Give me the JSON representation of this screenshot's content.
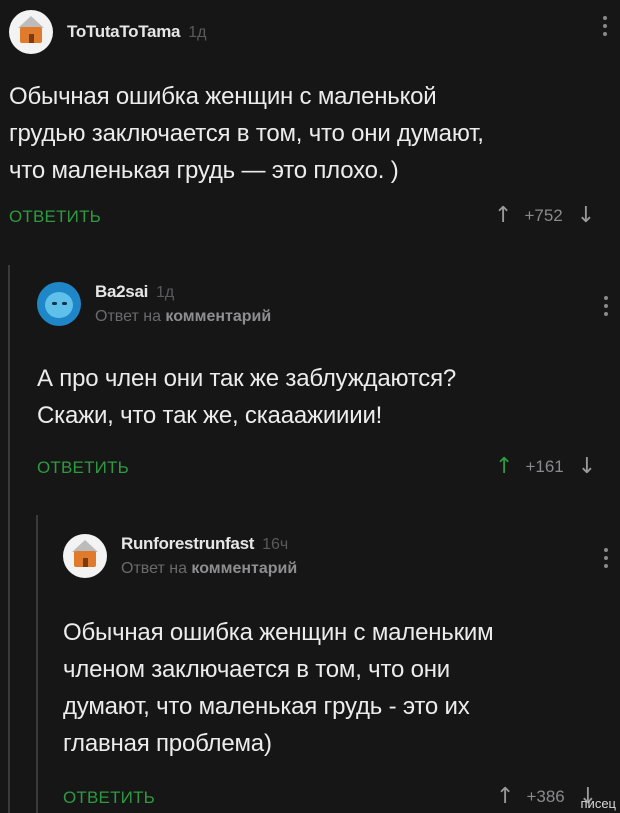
{
  "comments": [
    {
      "username": "ToTutaToTama",
      "time": "1д",
      "text": "Обычная ошибка женщин с маленькой\nгрудью заключается в том, что они думают,\nчто маленькая грудь — это плохо. )",
      "reply_label": "ОТВЕТИТЬ",
      "score": "+752",
      "avatar": "house-icon"
    },
    {
      "username": "Ba2sai",
      "time": "1д",
      "reply_to_prefix": "Ответ на",
      "reply_to_target": "комментарий",
      "text": "А про член они так же заблуждаются?\nСкажи,  что так же, скааажииии!",
      "reply_label": "ОТВЕТИТЬ",
      "score": "+161",
      "avatar": "blue-face-icon"
    },
    {
      "username": "Runforestrunfast",
      "time": "16ч",
      "reply_to_prefix": "Ответ на",
      "reply_to_target": "комментарий",
      "text": "Обычная ошибка женщин с маленьким\nчленом заключается в том, что они\nдумают, что маленькая грудь - это их\nглавная проблема)",
      "reply_label": "ОТВЕТИТЬ",
      "score": "+386",
      "avatar": "house-icon"
    }
  ],
  "watermark": "писец",
  "colors": {
    "background": "#161617",
    "accent_green": "#2e9a3f",
    "thread_line": "#3a3a3c"
  }
}
